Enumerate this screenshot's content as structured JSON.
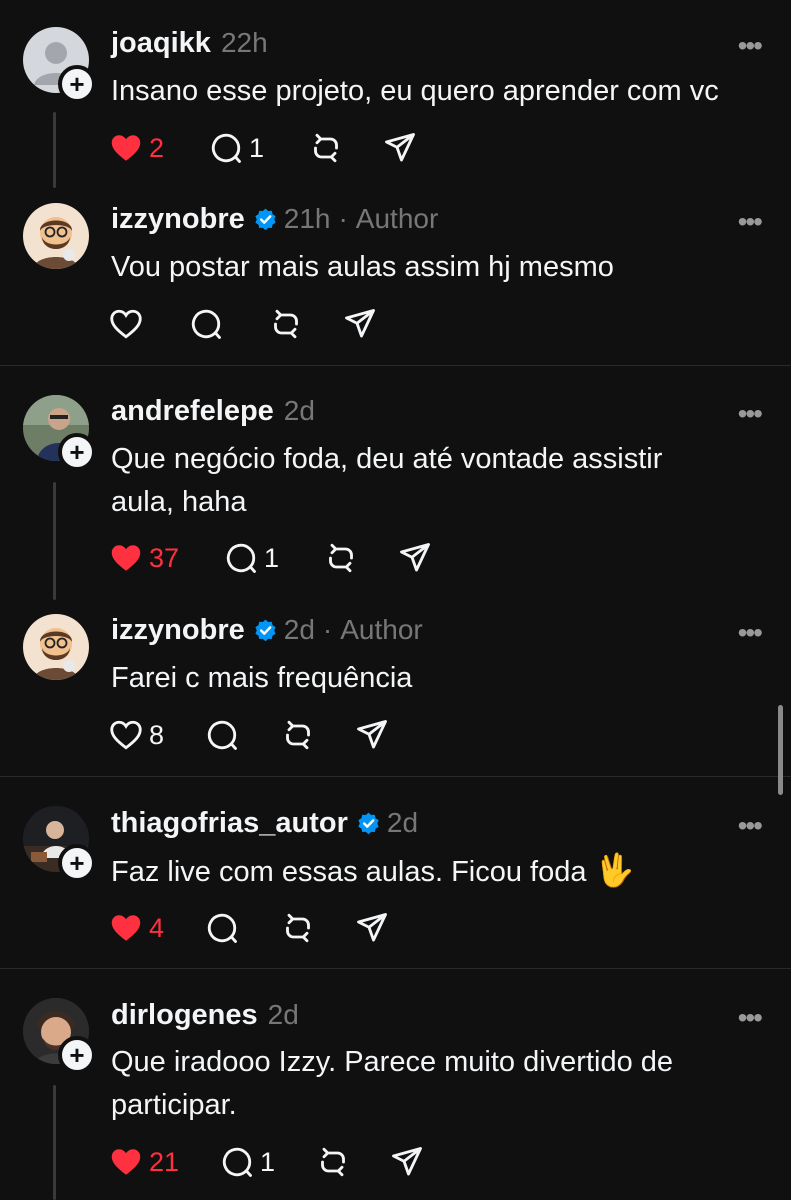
{
  "comments": [
    {
      "username": "joaqikk",
      "time": "22h",
      "author_tag": "",
      "verified": false,
      "text": "Insano esse projeto, eu quero aprender com vc",
      "liked": true,
      "likes": "2",
      "replies": "1",
      "avatar": "default"
    },
    {
      "username": "izzynobre",
      "time": "21h",
      "author_tag": "Author",
      "verified": true,
      "text": "Vou postar mais aulas assim hj mesmo",
      "liked": false,
      "likes": "",
      "replies": "",
      "avatar": "cartoon"
    },
    {
      "username": "andrefelepe",
      "time": "2d",
      "author_tag": "",
      "verified": false,
      "text": "Que negócio foda, deu até vontade assistir aula, haha",
      "liked": true,
      "likes": "37",
      "replies": "1",
      "avatar": "photo"
    },
    {
      "username": "izzynobre",
      "time": "2d",
      "author_tag": "Author",
      "verified": true,
      "text": "Farei c mais frequência",
      "liked": false,
      "likes": "8",
      "replies": "",
      "avatar": "cartoon"
    },
    {
      "username": "thiagofrias_autor",
      "time": "2d",
      "author_tag": "",
      "verified": true,
      "text": "Faz live com essas aulas. Ficou foda",
      "emoji": "🖖",
      "liked": true,
      "likes": "4",
      "replies": "",
      "avatar": "photo"
    },
    {
      "username": "dirlogenes",
      "time": "2d",
      "author_tag": "",
      "verified": false,
      "text": "Que iradooo Izzy. Parece muito divertido de participar.",
      "liked": true,
      "likes": "21",
      "replies": "1",
      "avatar": "photo"
    }
  ],
  "ui": {
    "meta_separator": "·",
    "more_glyph": "•••",
    "plus_glyph": "+"
  },
  "colors": {
    "background": "#101010",
    "text": "#f3f5f7",
    "muted": "#777777",
    "like_red": "#ff3040",
    "verified_blue": "#0095f6"
  },
  "icons": [
    "heart-icon",
    "comment-icon",
    "repost-icon",
    "share-icon",
    "verified-badge-icon",
    "more-icon",
    "follow-plus-icon"
  ]
}
